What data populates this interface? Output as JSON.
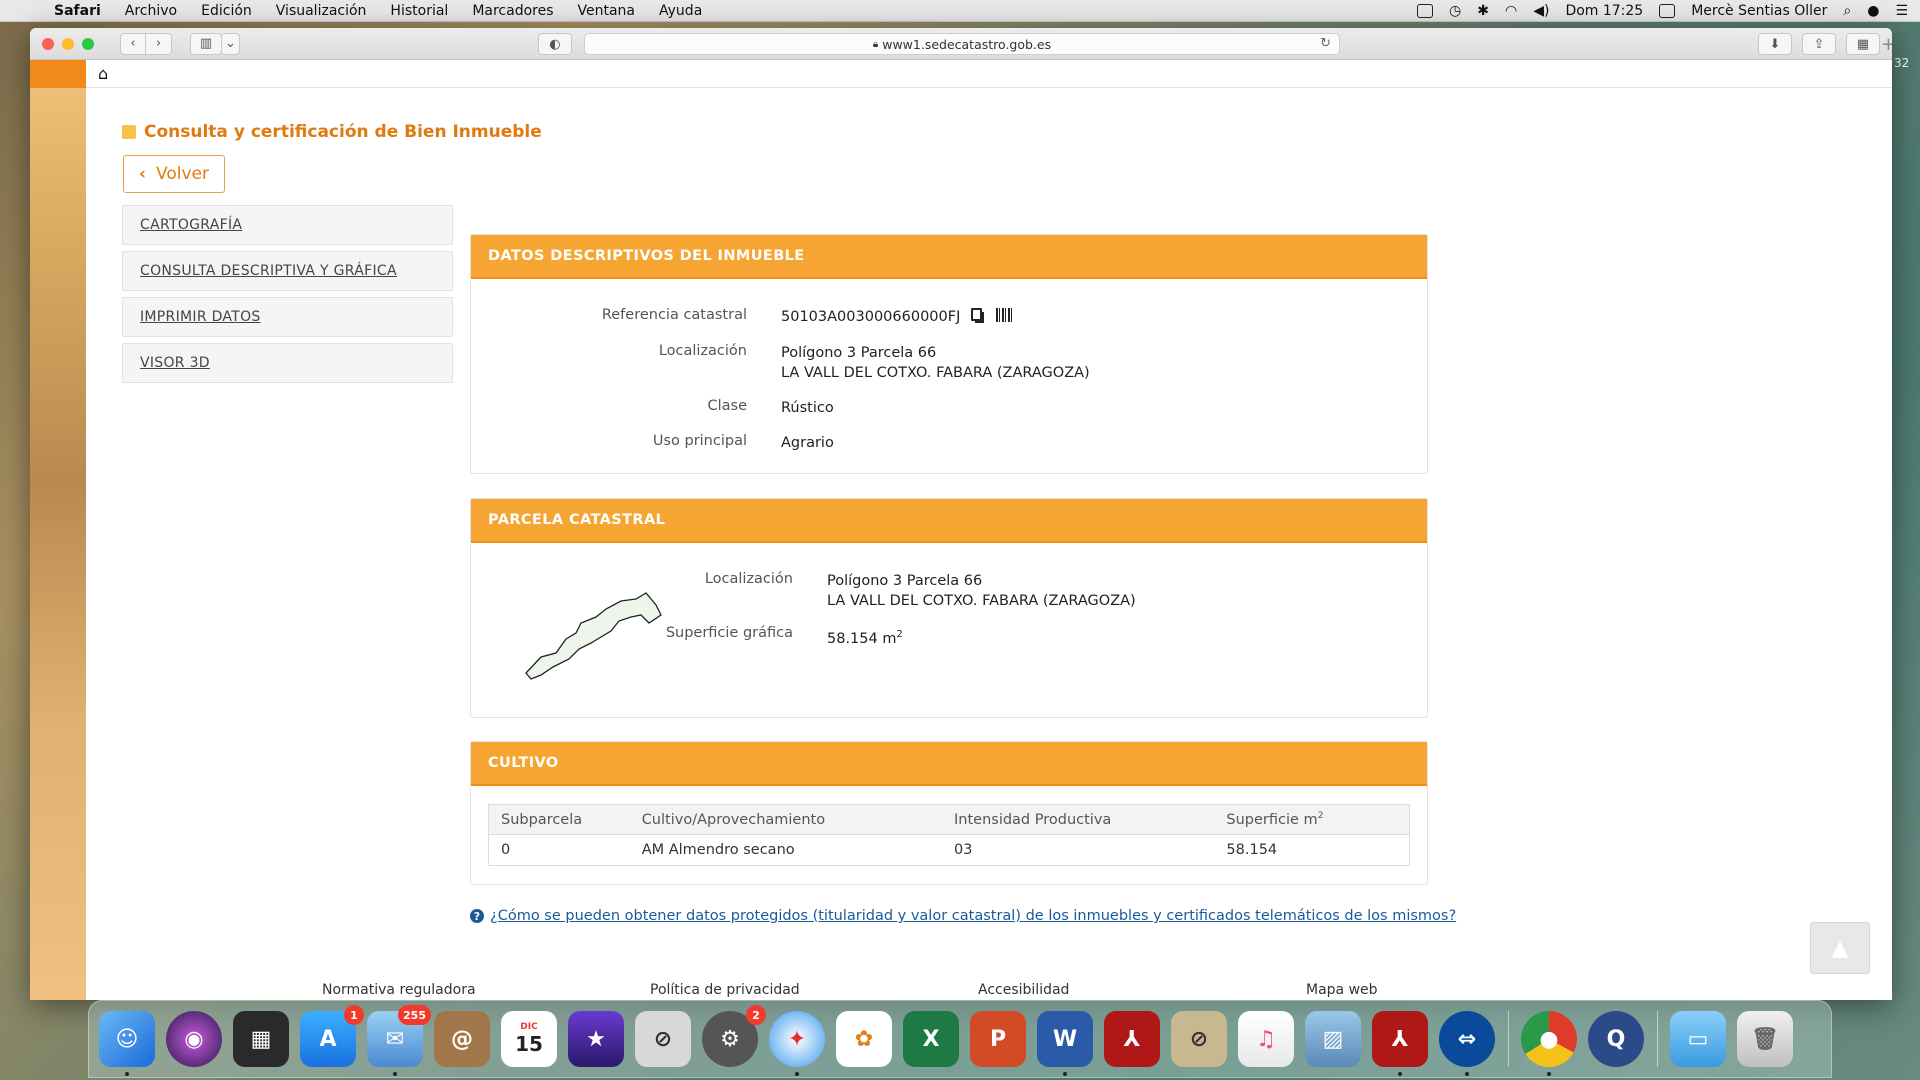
{
  "menubar": {
    "app": "Safari",
    "items": [
      "Archivo",
      "Edición",
      "Visualización",
      "Historial",
      "Marcadores",
      "Ventana",
      "Ayuda"
    ],
    "clock": "Dom 17:25",
    "user": "Mercè Sentias Oller"
  },
  "browser": {
    "url": "www1.sedecatastro.gob.es"
  },
  "page": {
    "title": "Consulta y certificación de Bien Inmueble",
    "back_label": "Volver",
    "sidenav": [
      "CARTOGRAFÍA",
      "CONSULTA DESCRIPTIVA Y GRÁFICA",
      "IMPRIMIR DATOS",
      "VISOR 3D"
    ]
  },
  "datos": {
    "heading": "DATOS DESCRIPTIVOS DEL INMUEBLE",
    "ref_label": "Referencia catastral",
    "ref_value": "50103A003000660000FJ",
    "loc_label": "Localización",
    "loc_line1": "Polígono 3 Parcela 66",
    "loc_line2": "LA VALL DEL COTXO. FABARA (ZARAGOZA)",
    "clase_label": "Clase",
    "clase_value": "Rústico",
    "uso_label": "Uso principal",
    "uso_value": "Agrario"
  },
  "parcela": {
    "heading": "PARCELA CATASTRAL",
    "loc_label": "Localización",
    "loc_line1": "Polígono 3 Parcela 66",
    "loc_line2": "LA VALL DEL COTXO. FABARA (ZARAGOZA)",
    "sup_label": "Superficie gráfica",
    "sup_value": "58.154 m",
    "sup_unit_sup": "2"
  },
  "cultivo": {
    "heading": "CULTIVO",
    "columns": [
      "Subparcela",
      "Cultivo/Aprovechamiento",
      "Intensidad Productiva",
      "Superficie m"
    ],
    "col_sup": "2",
    "rows": [
      [
        "0",
        "AM Almendro secano",
        "03",
        "58.154"
      ]
    ]
  },
  "help_link": "¿Cómo se pueden obtener datos protegidos (titularidad y valor catastral) de los inmuebles y certificados telemáticos de los mismos?",
  "footer": [
    "Normativa reguladora",
    "Política de privacidad",
    "Accesibilidad",
    "Mapa web"
  ],
  "dock": {
    "badges": {
      "appstore": "1",
      "mail": "255",
      "prefs": "2"
    },
    "calendar_month": "DIC",
    "calendar_day": "15"
  },
  "edge_text": "32"
}
